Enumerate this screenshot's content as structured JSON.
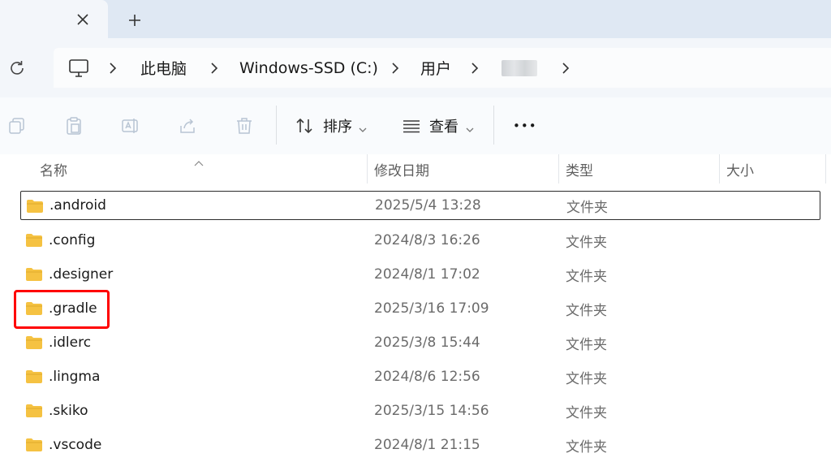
{
  "tabbar": {
    "close_icon": "close-icon",
    "newtab_icon": "plus-icon"
  },
  "address": {
    "refresh_icon": "refresh-icon",
    "computer_icon": "computer-icon",
    "crumbs": [
      "此电脑",
      "Windows-SSD (C:)",
      "用户"
    ]
  },
  "toolbar": {
    "icons": [
      "copy-icon",
      "paste-icon",
      "rename-icon",
      "share-icon",
      "delete-icon"
    ],
    "sort_label": "排序",
    "view_label": "查看",
    "more_label": "•••"
  },
  "columns": {
    "name": "名称",
    "date": "修改日期",
    "type": "类型",
    "size": "大小"
  },
  "files": [
    {
      "name": ".android",
      "date": "2025/5/4 13:28",
      "type": "文件夹"
    },
    {
      "name": ".config",
      "date": "2024/8/3 16:26",
      "type": "文件夹"
    },
    {
      "name": ".designer",
      "date": "2024/8/1 17:02",
      "type": "文件夹"
    },
    {
      "name": ".gradle",
      "date": "2025/3/16 17:09",
      "type": "文件夹"
    },
    {
      "name": ".idlerc",
      "date": "2025/3/8 15:44",
      "type": "文件夹"
    },
    {
      "name": ".lingma",
      "date": "2024/8/6 12:56",
      "type": "文件夹"
    },
    {
      "name": ".skiko",
      "date": "2025/3/15 14:56",
      "type": "文件夹"
    },
    {
      "name": ".vscode",
      "date": "2024/8/1 21:15",
      "type": "文件夹"
    }
  ],
  "colors": {
    "folder": "#f5c242",
    "highlight": "#ff0000",
    "tabbar_bg": "#dfe8f3"
  }
}
